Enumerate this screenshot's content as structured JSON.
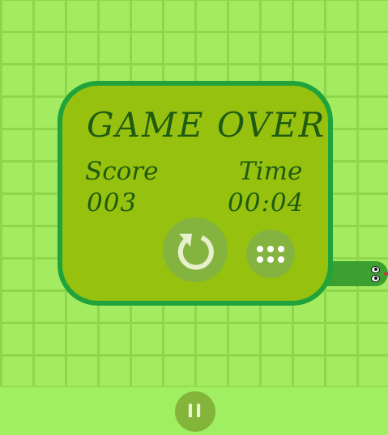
{
  "game": {
    "title": "GAME OVER",
    "score_label": "Score",
    "score_value": "003",
    "time_label": "Time",
    "time_value": "00:04"
  },
  "controls": {
    "restart_icon": "restart-icon",
    "menu_icon": "dots-grid-icon",
    "pause_label": "II"
  },
  "colors": {
    "board": "#a3ec61",
    "grid_line": "#8fd64c",
    "dialog_fill": "#96c10e",
    "dialog_border": "#20a33a",
    "text": "#1f5a12",
    "snake": "#3ba02f",
    "button": "#84b43f"
  }
}
